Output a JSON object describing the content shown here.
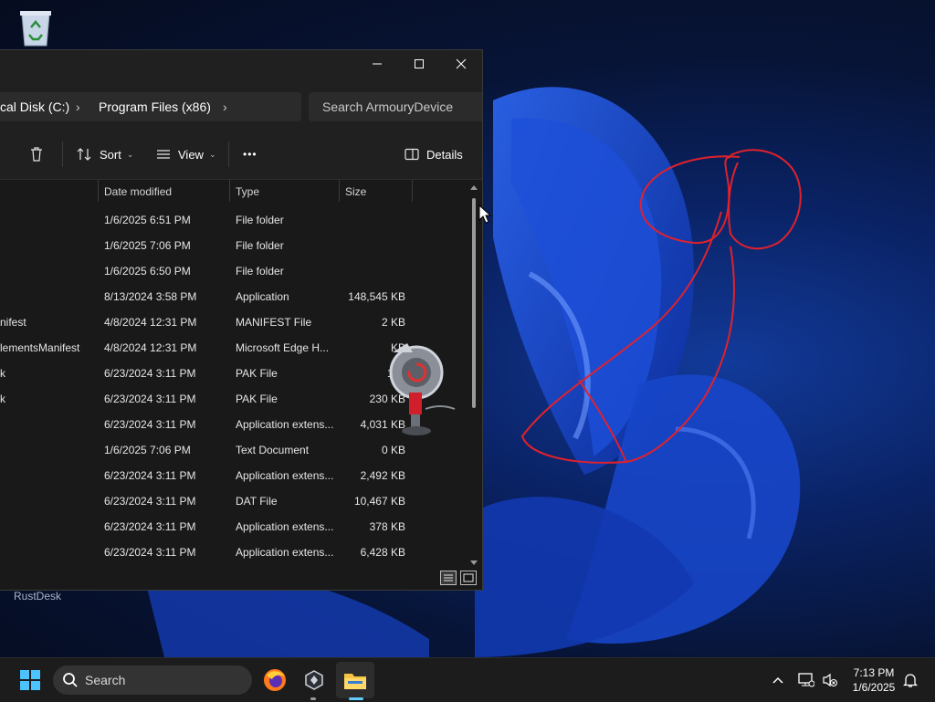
{
  "desktop": {
    "shortcut_label": "RustDesk"
  },
  "explorer": {
    "breadcrumb": [
      "cal Disk (C:)",
      "Program Files (x86)"
    ],
    "search_placeholder": "Search ArmouryDevice",
    "toolbar": {
      "sort": "Sort",
      "view": "View",
      "more": "•••",
      "details": "Details"
    },
    "columns": {
      "date": "Date modified",
      "type": "Type",
      "size": "Size"
    },
    "files": [
      {
        "name": "",
        "date": "1/6/2025 6:51 PM",
        "type": "File folder",
        "size": ""
      },
      {
        "name": "",
        "date": "1/6/2025 7:06 PM",
        "type": "File folder",
        "size": ""
      },
      {
        "name": "",
        "date": "1/6/2025 6:50 PM",
        "type": "File folder",
        "size": ""
      },
      {
        "name": "",
        "date": "8/13/2024 3:58 PM",
        "type": "Application",
        "size": "148,545 KB"
      },
      {
        "name": "nifest",
        "date": "4/8/2024 12:31 PM",
        "type": "MANIFEST File",
        "size": "2 KB"
      },
      {
        "name": "lementsManifest",
        "date": "4/8/2024 12:31 PM",
        "type": "Microsoft Edge H...",
        "size": "KB"
      },
      {
        "name": "k",
        "date": "6/23/2024 3:11 PM",
        "type": "PAK File",
        "size": "151"
      },
      {
        "name": "k",
        "date": "6/23/2024 3:11 PM",
        "type": "PAK File",
        "size": "230 KB"
      },
      {
        "name": "",
        "date": "6/23/2024 3:11 PM",
        "type": "Application extens...",
        "size": "4,031 KB"
      },
      {
        "name": "",
        "date": "1/6/2025 7:06 PM",
        "type": "Text Document",
        "size": "0 KB"
      },
      {
        "name": "",
        "date": "6/23/2024 3:11 PM",
        "type": "Application extens...",
        "size": "2,492 KB"
      },
      {
        "name": "",
        "date": "6/23/2024 3:11 PM",
        "type": "DAT File",
        "size": "10,467 KB"
      },
      {
        "name": "",
        "date": "6/23/2024 3:11 PM",
        "type": "Application extens...",
        "size": "378 KB"
      },
      {
        "name": "",
        "date": "6/23/2024 3:11 PM",
        "type": "Application extens...",
        "size": "6,428 KB"
      }
    ]
  },
  "taskbar": {
    "search_label": "Search",
    "time": "7:13 PM",
    "date": "1/6/2025",
    "accent": "#60cdff"
  },
  "colors": {
    "ink": "#e0212d",
    "window_bg": "#191919"
  }
}
